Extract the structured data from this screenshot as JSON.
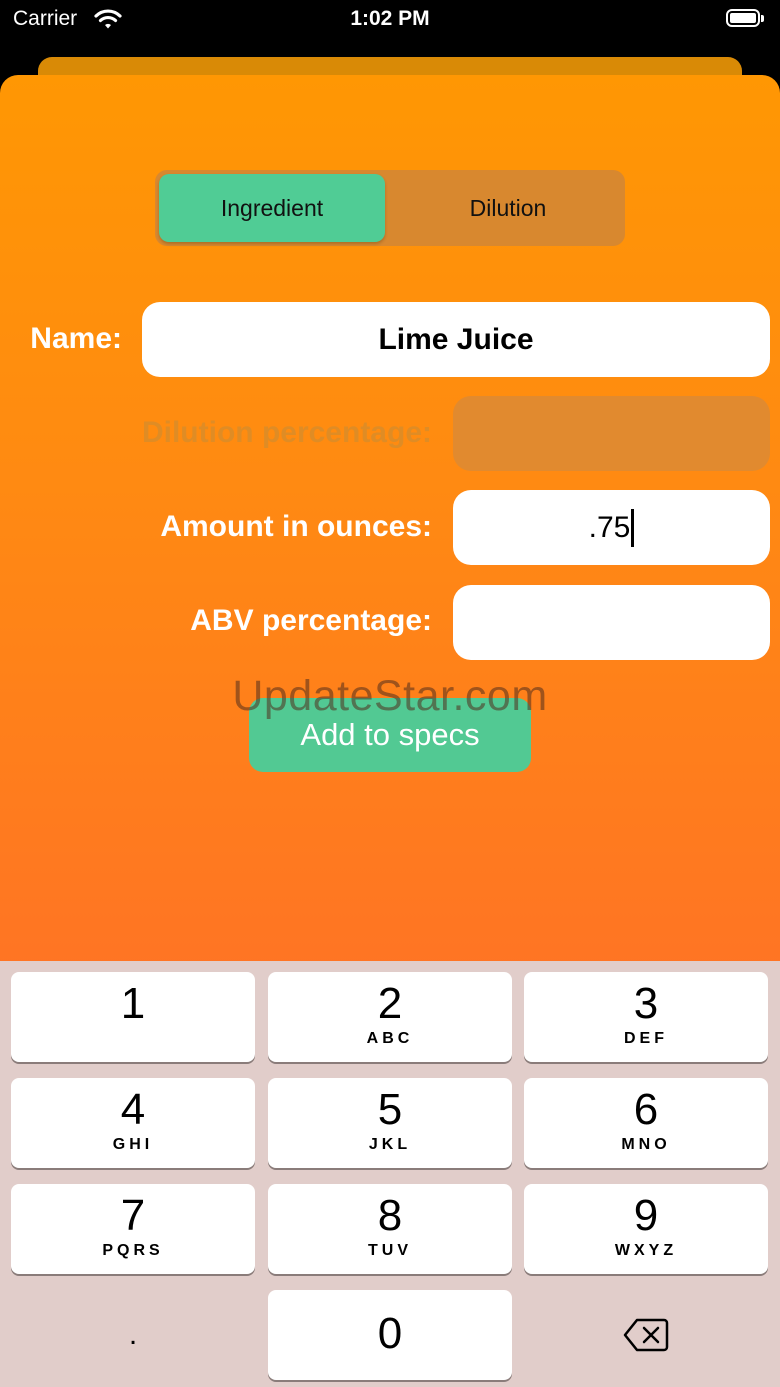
{
  "status_bar": {
    "carrier": "Carrier",
    "time": "1:02 PM"
  },
  "segmented_control": {
    "selected": "Ingredient",
    "options": [
      "Ingredient",
      "Dilution"
    ]
  },
  "form": {
    "name_label": "Name:",
    "name_value": "Lime Juice",
    "dilution_label": "Dilution percentage:",
    "dilution_value": "",
    "amount_label": "Amount in ounces:",
    "amount_value": ".75",
    "abv_label": "ABV percentage:",
    "abv_value": ""
  },
  "add_button": "Add to specs",
  "watermark": "UpdateStar.com",
  "colors": {
    "accent_green": "#50cc95",
    "sheet_orange": "#ff8a12"
  },
  "keyboard": {
    "keys": [
      {
        "num": "1",
        "letters": ""
      },
      {
        "num": "2",
        "letters": "ABC"
      },
      {
        "num": "3",
        "letters": "DEF"
      },
      {
        "num": "4",
        "letters": "GHI"
      },
      {
        "num": "5",
        "letters": "JKL"
      },
      {
        "num": "6",
        "letters": "MNO"
      },
      {
        "num": "7",
        "letters": "PQRS"
      },
      {
        "num": "8",
        "letters": "TUV"
      },
      {
        "num": "9",
        "letters": "WXYZ"
      },
      {
        "num": "0",
        "letters": ""
      }
    ],
    "dot": ".",
    "delete_icon": "backspace-icon"
  }
}
